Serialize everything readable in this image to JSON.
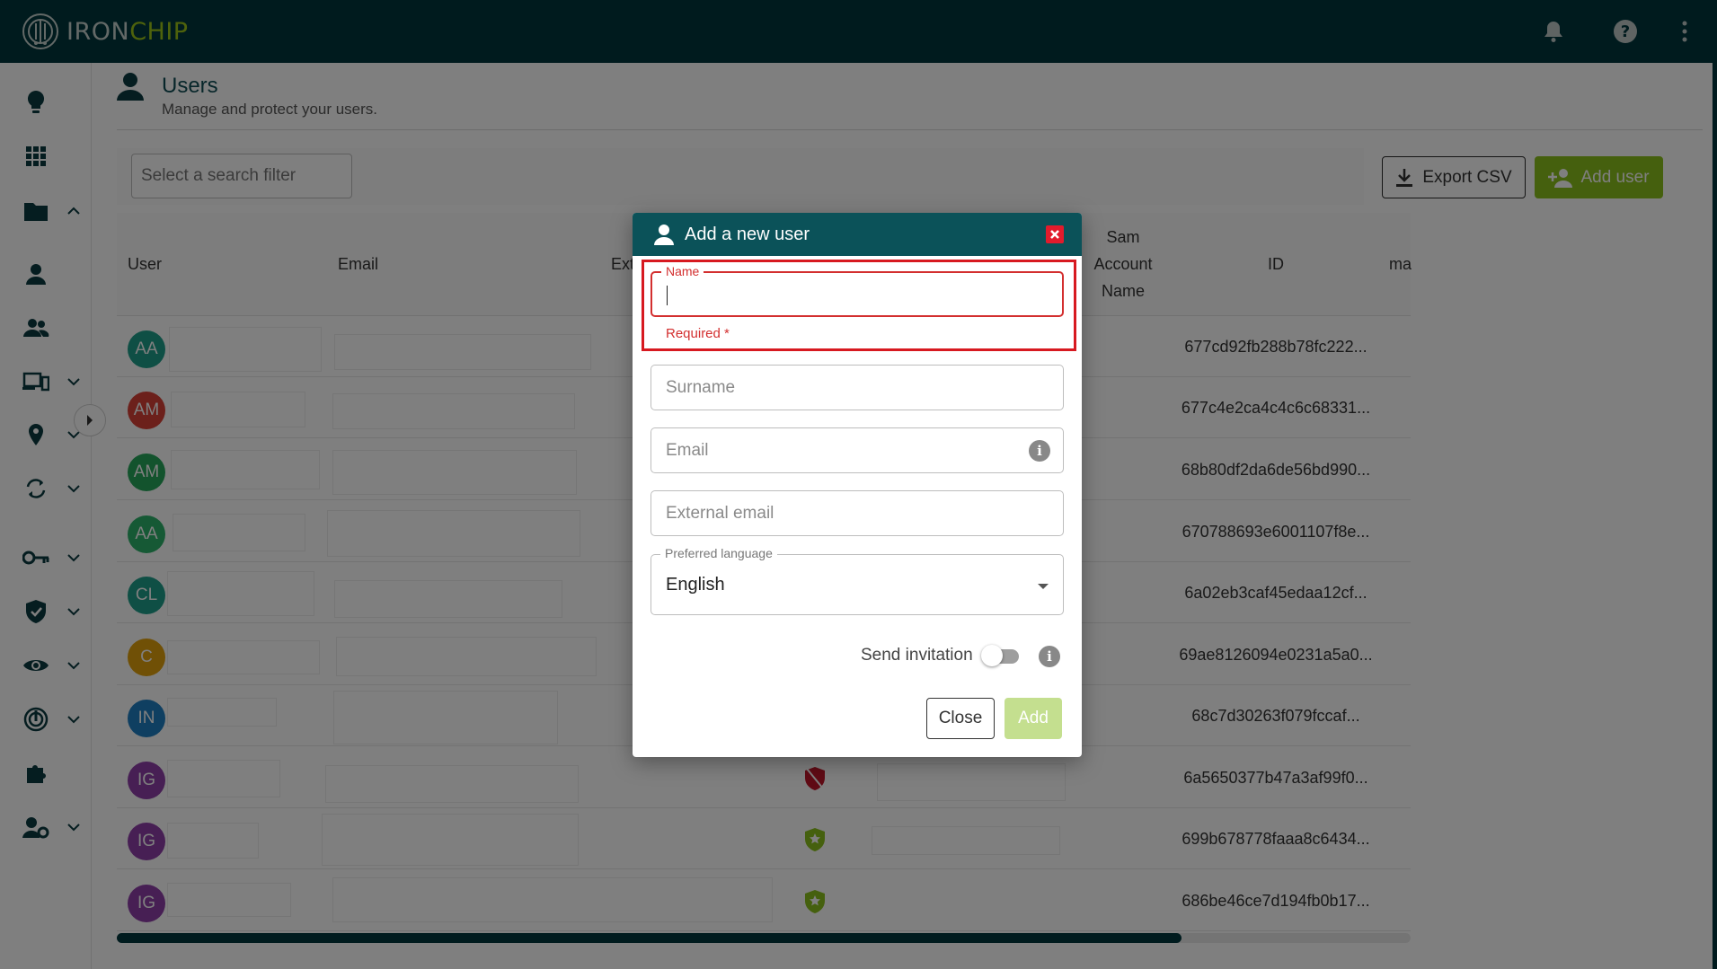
{
  "app": {
    "logo_iron": "IRON",
    "logo_chip": "CHIP",
    "colors": {
      "topbar": "#00363c",
      "accent_green": "#8bc11c",
      "error_red": "#d32f2f"
    }
  },
  "topbar_icons": [
    "bell-icon",
    "help-icon",
    "more-vert-icon"
  ],
  "sidebar": {
    "items": [
      {
        "icon": "lightbulb-icon"
      },
      {
        "icon": "grid-icon"
      },
      {
        "icon": "folder-icon",
        "chevron": "up"
      },
      {
        "icon": "user-icon"
      },
      {
        "icon": "users-icon"
      },
      {
        "icon": "devices-icon",
        "chevron": "down"
      },
      {
        "icon": "location-icon",
        "chevron": "down"
      },
      {
        "icon": "sync-icon",
        "chevron": "down"
      },
      {
        "icon": "key-icon",
        "chevron": "down"
      },
      {
        "icon": "shield-icon",
        "chevron": "down"
      },
      {
        "icon": "eye-icon",
        "chevron": "down"
      },
      {
        "icon": "fingerprint-icon",
        "chevron": "down"
      },
      {
        "icon": "puzzle-icon"
      },
      {
        "icon": "user-settings-icon",
        "chevron": "down"
      }
    ]
  },
  "page": {
    "title": "Users",
    "subtitle": "Manage and protect your users."
  },
  "toolbar": {
    "search_placeholder": "Select a search filter",
    "export_label": "Export CSV",
    "add_user_label": "Add user"
  },
  "table": {
    "headers": {
      "user": "User",
      "email": "Email",
      "ext": "Ext",
      "sam_1": "Sam",
      "sam_2": "Account",
      "sam_3": "Name",
      "id": "ID",
      "ma": "ma"
    },
    "rows": [
      {
        "initials": "AA",
        "color": "#1e9e8a",
        "id": "677cd92fb288b78fc222..."
      },
      {
        "initials": "AM",
        "color": "#d84036",
        "id": "677c4e2ca4c4c6c68331..."
      },
      {
        "initials": "AM",
        "color": "#26a65b",
        "id": "68b80df2da6de56bd990..."
      },
      {
        "initials": "AA",
        "color": "#2cb36a",
        "id": "670788693e6001107f8e..."
      },
      {
        "initials": "CL",
        "color": "#1e9e8a",
        "id": "6a02eb3caf45edaa12cf..."
      },
      {
        "initials": "C",
        "color": "#e0a00c",
        "id": "69ae8126094e0231a5a0..."
      },
      {
        "initials": "IN",
        "color": "#1f7fc2",
        "id": "68c7d30263f079fccaf..."
      },
      {
        "initials": "IG",
        "color": "#8e3fa8",
        "id": "6a5650377b47a3af99f0...",
        "status": "disabled"
      },
      {
        "initials": "IG",
        "color": "#8e3fa8",
        "id": "699b678778faaa8c6434...",
        "status": "protected"
      },
      {
        "initials": "IG",
        "color": "#8e3fa8",
        "id": "686be46ce7d194fb0b17...",
        "status": "protected"
      }
    ]
  },
  "modal": {
    "title": "Add a new user",
    "name_label": "Name",
    "name_value": "",
    "name_error": "Required *",
    "surname_placeholder": "Surname",
    "email_placeholder": "Email",
    "external_email_placeholder": "External email",
    "language_label": "Preferred language",
    "language_value": "English",
    "send_invitation_label": "Send invitation",
    "send_invitation_on": false,
    "close_label": "Close",
    "add_label": "Add"
  }
}
